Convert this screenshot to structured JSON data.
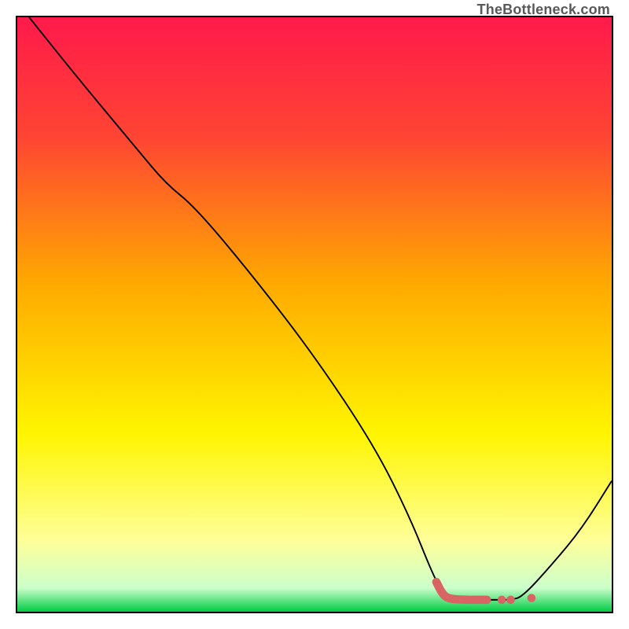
{
  "watermark": "TheBottleneck.com",
  "chart_data": {
    "type": "line",
    "title": "",
    "xlabel": "",
    "ylabel": "",
    "ylim": [
      0,
      100
    ],
    "xlim": [
      0,
      100
    ],
    "gradient_stops": [
      {
        "offset": 0,
        "color": "#ff1a4b"
      },
      {
        "offset": 20,
        "color": "#ff4433"
      },
      {
        "offset": 45,
        "color": "#ffaa00"
      },
      {
        "offset": 70,
        "color": "#fff500"
      },
      {
        "offset": 88,
        "color": "#ffff99"
      },
      {
        "offset": 96,
        "color": "#ccffcc"
      },
      {
        "offset": 100,
        "color": "#00cc44"
      }
    ],
    "series": [
      {
        "name": "bottleneck-curve",
        "color": "#000000",
        "points_xy": [
          [
            2,
            100
          ],
          [
            10,
            90
          ],
          [
            20,
            78
          ],
          [
            25,
            72
          ],
          [
            30,
            68
          ],
          [
            40,
            56
          ],
          [
            50,
            43
          ],
          [
            60,
            28
          ],
          [
            66,
            16
          ],
          [
            70,
            6
          ],
          [
            72,
            2.5
          ],
          [
            75,
            2
          ],
          [
            80,
            2
          ],
          [
            83,
            2
          ],
          [
            85,
            2.5
          ],
          [
            90,
            8
          ],
          [
            95,
            14
          ],
          [
            100,
            22
          ]
        ]
      }
    ],
    "highlight": {
      "name": "optimal-range-marker",
      "color": "#d86464",
      "points_xy": [
        [
          70.5,
          5
        ],
        [
          71.5,
          3
        ],
        [
          72.5,
          2.2
        ],
        [
          75,
          2
        ],
        [
          79,
          2
        ]
      ],
      "dots_xy": [
        [
          81.5,
          2
        ],
        [
          83,
          2
        ],
        [
          86.5,
          2.3
        ]
      ]
    }
  }
}
